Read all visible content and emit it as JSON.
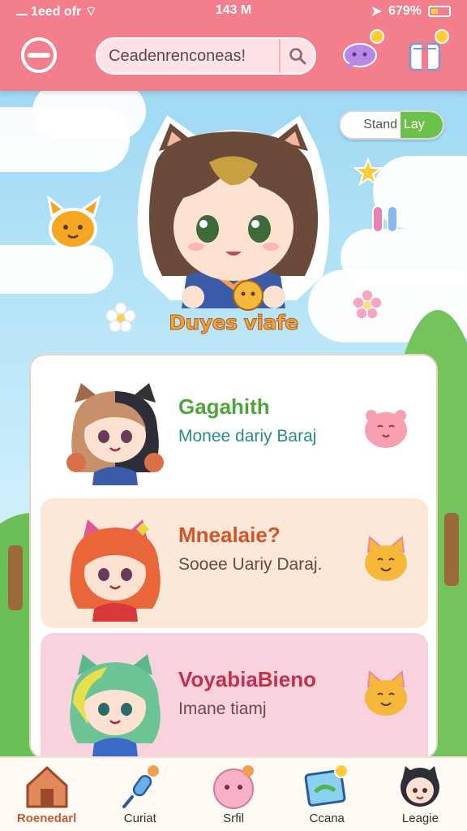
{
  "status_bar": {
    "carrier": "1eed ofr",
    "time": "143 M",
    "battery": "679%"
  },
  "header": {
    "search_placeholder": "Ceadenrenconeas!"
  },
  "status_toggle": {
    "left": "Stand",
    "right": "Lay"
  },
  "hero": {
    "caption": "Duyes viafe"
  },
  "cards": [
    {
      "title": "Gagahith",
      "subtitle": "Monee dariy Baraj",
      "title_color": "#4ea63a",
      "subtitle_color": "#2a8a8a",
      "bg": "#ffffff",
      "pet": "pink-blob-pet-icon"
    },
    {
      "title": "Mnealaie?",
      "subtitle": "Sooee Uariy Daraj.",
      "title_color": "#d0562a",
      "subtitle_color": "#6b4a3a",
      "bg": "#fbe8d8",
      "pet": "orange-cat-pet-icon"
    },
    {
      "title": "VoyabiaBieno",
      "subtitle": "Imane tiamj",
      "title_color": "#c2324e",
      "subtitle_color": "#6b4a4a",
      "bg": "#f8d2dc",
      "pet": "orange-cat-pet-icon"
    }
  ],
  "bottom_nav": [
    {
      "label": "Roenedarl",
      "icon": "house-icon",
      "active": true
    },
    {
      "label": "Curiat",
      "icon": "microphone-icon",
      "active": false
    },
    {
      "label": "Srfil",
      "icon": "pink-blob-icon",
      "active": false
    },
    {
      "label": "Ccana",
      "icon": "map-icon",
      "active": false
    },
    {
      "label": "Leagie",
      "icon": "profile-avatar-icon",
      "active": false
    }
  ]
}
